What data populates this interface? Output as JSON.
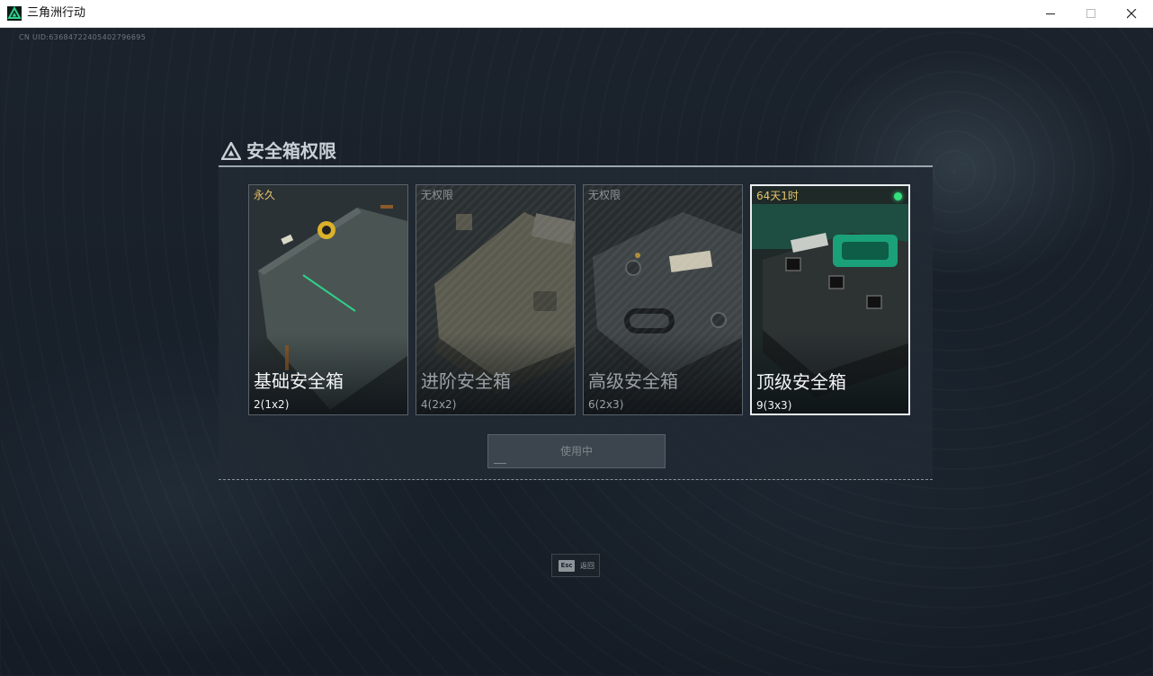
{
  "window": {
    "title": "三角洲行动"
  },
  "game": {
    "uid": "CN UID:6368472240540279669​5"
  },
  "dialog": {
    "title": "安全箱权限"
  },
  "cards": [
    {
      "status": "永久",
      "name": "基础安全箱",
      "capacity": "2(1x2)"
    },
    {
      "status": "无权限",
      "name": "进阶安全箱",
      "capacity": "4(2x2)"
    },
    {
      "status": "无权限",
      "name": "高级安全箱",
      "capacity": "6(2x3)"
    },
    {
      "status": "64天1时",
      "name": "顶级安全箱",
      "capacity": "9(3x3)"
    }
  ],
  "action": {
    "label": "使用中"
  },
  "footer": {
    "esc_key": "Esc",
    "esc_label": "返回"
  },
  "colors": {
    "accent_gold": "#e7c36a",
    "active_dot": "#35e07e",
    "selected_border": "#e9eef0"
  }
}
